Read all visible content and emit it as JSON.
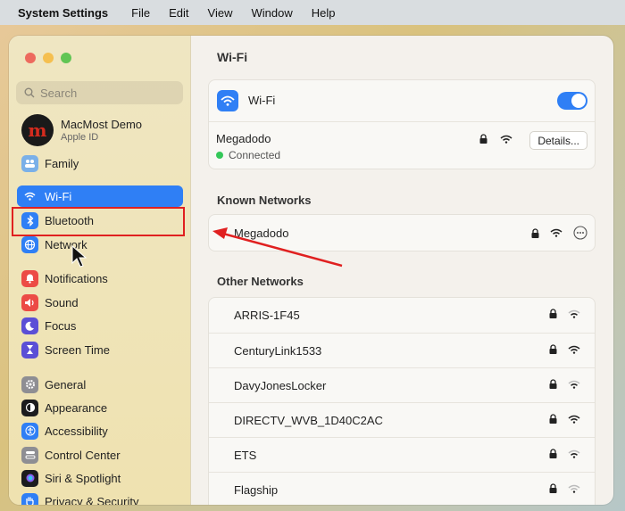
{
  "menubar": {
    "app": "System Settings",
    "items": [
      "File",
      "Edit",
      "View",
      "Window",
      "Help"
    ]
  },
  "sidebar": {
    "search_placeholder": "Search",
    "account": {
      "name": "MacMost Demo",
      "sub": "Apple ID",
      "avatar_letter": "m"
    },
    "family": "Family",
    "items": [
      {
        "label": "Wi-Fi",
        "icon": "wifi-icon",
        "color": "#2f7ff5"
      },
      {
        "label": "Bluetooth",
        "icon": "bluetooth-icon",
        "color": "#2f7ff5"
      },
      {
        "label": "Network",
        "icon": "globe-icon",
        "color": "#2f7ff5"
      },
      {
        "label": "Notifications",
        "icon": "bell-icon",
        "color": "#ec4b45"
      },
      {
        "label": "Sound",
        "icon": "speaker-icon",
        "color": "#ec4b45"
      },
      {
        "label": "Focus",
        "icon": "moon-icon",
        "color": "#5b4fd6"
      },
      {
        "label": "Screen Time",
        "icon": "hourglass-icon",
        "color": "#5b4fd6"
      },
      {
        "label": "General",
        "icon": "gear-icon",
        "color": "#8e8e93"
      },
      {
        "label": "Appearance",
        "icon": "appearance-icon",
        "color": "#1c1c1e"
      },
      {
        "label": "Accessibility",
        "icon": "accessibility-icon",
        "color": "#2f7ff5"
      },
      {
        "label": "Control Center",
        "icon": "control-center-icon",
        "color": "#8e8e93"
      },
      {
        "label": "Siri & Spotlight",
        "icon": "siri-icon",
        "color": "#1c1c1e"
      },
      {
        "label": "Privacy & Security",
        "icon": "hand-icon",
        "color": "#2f7ff5"
      }
    ]
  },
  "main": {
    "title": "Wi-Fi",
    "wifi_toggle_label": "Wi-Fi",
    "wifi_enabled": true,
    "current": {
      "name": "Megadodo",
      "status": "Connected",
      "details": "Details..."
    },
    "known_title": "Known Networks",
    "known": [
      {
        "name": "Megadodo"
      }
    ],
    "other_title": "Other Networks",
    "other": [
      {
        "name": "ARRIS-1F45"
      },
      {
        "name": "CenturyLink1533"
      },
      {
        "name": "DavyJonesLocker"
      },
      {
        "name": "DIRECTV_WVB_1D40C2AC"
      },
      {
        "name": "ETS"
      },
      {
        "name": "Flagship"
      }
    ]
  },
  "annotation_color": "#e02020"
}
